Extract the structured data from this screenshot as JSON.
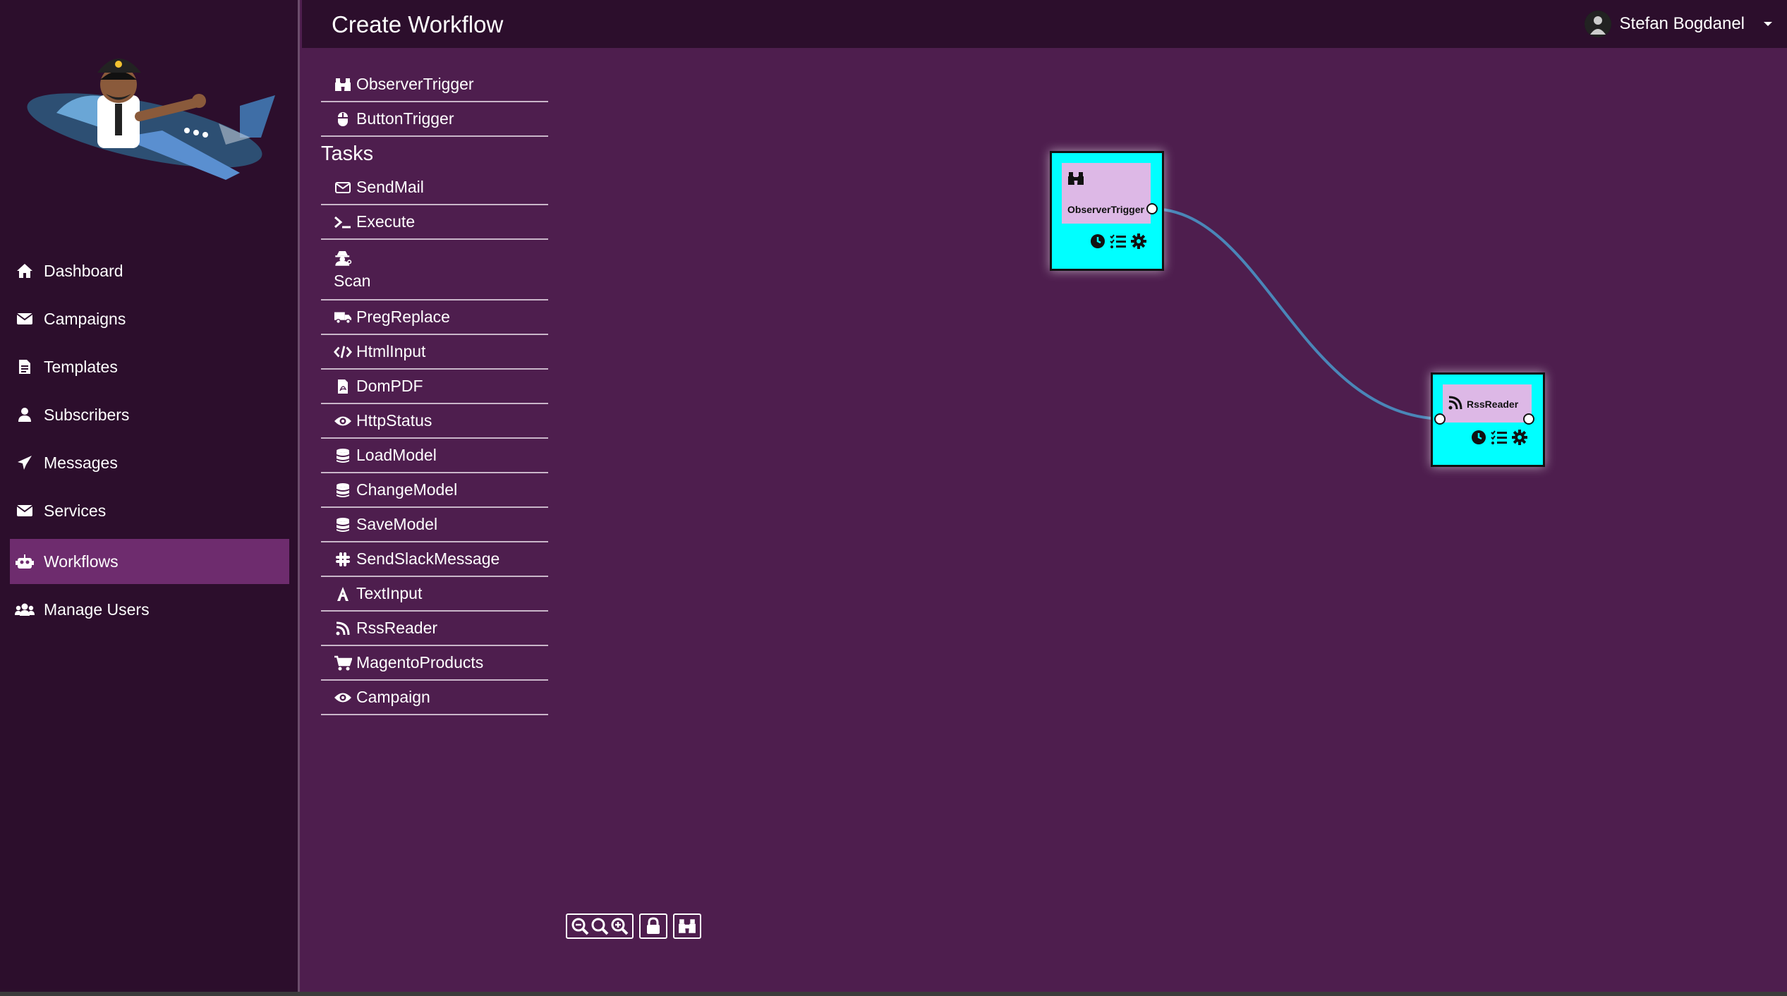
{
  "header": {
    "title": "Create Workflow",
    "user_name": "Stefan Bogdanel"
  },
  "sidebar": {
    "items": [
      {
        "label": "Dashboard",
        "icon": "home-icon"
      },
      {
        "label": "Campaigns",
        "icon": "envelope-icon"
      },
      {
        "label": "Templates",
        "icon": "file-icon"
      },
      {
        "label": "Subscribers",
        "icon": "user-icon"
      },
      {
        "label": "Messages",
        "icon": "paper-plane-icon"
      },
      {
        "label": "Services",
        "icon": "envelope-icon"
      },
      {
        "label": "Workflows",
        "icon": "robot-icon",
        "active": true
      },
      {
        "label": "Manage Users",
        "icon": "users-icon"
      }
    ]
  },
  "toolbox": {
    "triggers": [
      {
        "label": "ObserverTrigger",
        "icon": "binoculars-icon"
      },
      {
        "label": "ButtonTrigger",
        "icon": "mouse-icon"
      }
    ],
    "tasks_title": "Tasks",
    "tasks": [
      {
        "label": "SendMail",
        "icon": "envelope-icon"
      },
      {
        "label": "Execute",
        "icon": "terminal-icon"
      },
      {
        "label": "Scan",
        "icon": "user-secret-icon"
      },
      {
        "label": "PregReplace",
        "icon": "truck-icon"
      },
      {
        "label": "HtmlInput",
        "icon": "code-icon"
      },
      {
        "label": "DomPDF",
        "icon": "file-pdf-icon"
      },
      {
        "label": "HttpStatus",
        "icon": "eye-icon"
      },
      {
        "label": "LoadModel",
        "icon": "database-icon"
      },
      {
        "label": "ChangeModel",
        "icon": "database-icon"
      },
      {
        "label": "SaveModel",
        "icon": "database-icon"
      },
      {
        "label": "SendSlackMessage",
        "icon": "slack-icon"
      },
      {
        "label": "TextInput",
        "icon": "font-icon"
      },
      {
        "label": "RssReader",
        "icon": "rss-icon"
      },
      {
        "label": "MagentoProducts",
        "icon": "cart-icon"
      },
      {
        "label": "Campaign",
        "icon": "eye-icon"
      }
    ]
  },
  "canvas": {
    "nodes": [
      {
        "title": "ObserverTrigger",
        "icon": "binoculars-icon"
      },
      {
        "title": "RssReader",
        "icon": "rss-icon"
      }
    ],
    "connection": {
      "from": "ObserverTrigger",
      "to": "RssReader",
      "color": "#4a86b8"
    }
  },
  "colors": {
    "sidebar_bg": "#2c0e2c",
    "canvas_bg": "#4e1e4e",
    "active_item": "#6e2c6e",
    "node_fill": "#00ffff",
    "node_header": "#ddb8e6"
  }
}
